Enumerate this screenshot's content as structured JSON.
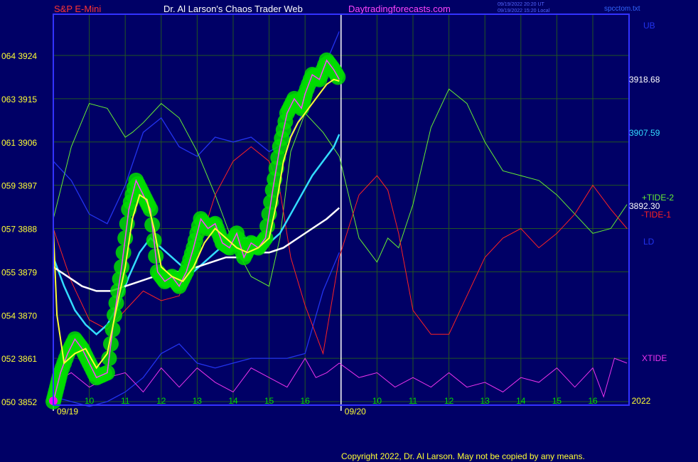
{
  "header": {
    "instrument": "S&P E-Mini",
    "site_title": "Dr. Al Larson's Chaos Trader Web",
    "website": "Daytradingforecasts.com",
    "time_ut": "09/19/2022 20:20 UT",
    "time_local": "09/19/2022 15:20 Local",
    "data_file": "spcctom.txt"
  },
  "footer": {
    "copyright": "Copyright 2022, Dr. Al Larson. May not be copied by any means."
  },
  "colors": {
    "background": "#000066",
    "frame": "#3333ff",
    "grid": "#225522",
    "price_green": "#00dd00",
    "price_magenta": "#ff44ff",
    "yellow_ma": "#ffff33",
    "cyan_ma": "#33ddff",
    "white_ma": "#ffffff",
    "band_blue": "#2233ee",
    "tide_green": "#66ee33",
    "tide_red": "#ff2222",
    "xtide": "#ee33ee"
  },
  "chart_data": {
    "type": "line",
    "title": "S&P E-Mini",
    "x_ticks": [
      "09/19",
      "10",
      "11",
      "12",
      "13",
      "14",
      "15",
      "16",
      "09/20",
      "10",
      "11",
      "12",
      "13",
      "14",
      "15",
      "16",
      "2022"
    ],
    "y_ticks": [
      {
        "value": 3852,
        "label": "050  3852"
      },
      {
        "value": 3861,
        "label": "052  3861"
      },
      {
        "value": 3870,
        "label": "054  3870"
      },
      {
        "value": 3879,
        "label": "055  3879"
      },
      {
        "value": 3888,
        "label": "057  3888"
      },
      {
        "value": 3897,
        "label": "059  3897"
      },
      {
        "value": 3906,
        "label": "061  3906"
      },
      {
        "value": 3915,
        "label": "063  3915"
      },
      {
        "value": 3924,
        "label": "064  3924"
      }
    ],
    "ylim": [
      3852,
      3924
    ],
    "grid": true,
    "right_labels": {
      "ub": "UB",
      "ld": "LD",
      "tide_plus": "+TIDE-2",
      "tide_minus": "-TIDE-1",
      "xtide": "XTIDE",
      "price_yellow": "3918.68",
      "price_cyan": "3907.59",
      "price_white": "3892.30"
    },
    "price_x": [
      0,
      0.1,
      0.2,
      0.4,
      0.6,
      0.8,
      1.0,
      1.2,
      1.5,
      1.7,
      1.9,
      2.1,
      2.3,
      2.5,
      2.7,
      2.9,
      3.1,
      3.3,
      3.5,
      3.7,
      3.9,
      4.1,
      4.3,
      4.5,
      4.7,
      4.9,
      5.1,
      5.3,
      5.5,
      5.7,
      5.9,
      6.1,
      6.3,
      6.5,
      6.7,
      6.9,
      7.0,
      7.2,
      7.4,
      7.6,
      7.8,
      7.95
    ],
    "price": [
      3852,
      3855,
      3858,
      3862,
      3865,
      3863,
      3860,
      3857,
      3858,
      3870,
      3880,
      3892,
      3898,
      3895,
      3892,
      3879,
      3877,
      3878,
      3876,
      3879,
      3884,
      3890,
      3888,
      3889,
      3885,
      3884,
      3887,
      3882,
      3885,
      3884,
      3886,
      3896,
      3905,
      3912,
      3915,
      3913,
      3916,
      3920,
      3919,
      3923,
      3921,
      3919
    ],
    "series": [
      {
        "name": "yellow",
        "x": [
          0,
          0.1,
          0.3,
          0.6,
          0.9,
          1.2,
          1.5,
          1.8,
          2.0,
          2.2,
          2.4,
          2.6,
          2.8,
          3.0,
          3.3,
          3.6,
          3.9,
          4.2,
          4.5,
          4.8,
          5.1,
          5.4,
          5.7,
          6.0,
          6.2,
          6.4,
          6.6,
          6.8,
          7.0,
          7.2,
          7.4,
          7.6,
          7.8,
          7.95
        ],
        "y": [
          3888,
          3870,
          3860,
          3862,
          3863,
          3859,
          3862,
          3873,
          3880,
          3890,
          3895,
          3894,
          3888,
          3880,
          3878,
          3877,
          3880,
          3885,
          3888,
          3886,
          3884,
          3883,
          3884,
          3886,
          3893,
          3902,
          3907,
          3910,
          3912,
          3914,
          3916,
          3918,
          3919,
          3918.68
        ]
      },
      {
        "name": "cyan",
        "x": [
          0,
          0.3,
          0.6,
          0.9,
          1.2,
          1.5,
          1.8,
          2.1,
          2.4,
          2.7,
          3.0,
          3.3,
          3.6,
          3.9,
          4.2,
          4.5,
          4.8,
          5.1,
          5.4,
          5.7,
          6.0,
          6.3,
          6.6,
          6.9,
          7.2,
          7.5,
          7.8,
          7.95
        ],
        "y": [
          3882,
          3876,
          3871,
          3868,
          3866,
          3868,
          3872,
          3878,
          3883,
          3886,
          3884,
          3882,
          3880,
          3879,
          3881,
          3883,
          3885,
          3886,
          3886,
          3885,
          3885,
          3887,
          3891,
          3895,
          3899,
          3902,
          3905,
          3907.59
        ]
      },
      {
        "name": "white",
        "x": [
          0,
          0.4,
          0.8,
          1.2,
          1.6,
          2.0,
          2.4,
          2.8,
          3.2,
          3.6,
          4.0,
          4.4,
          4.8,
          5.2,
          5.6,
          6.0,
          6.4,
          6.8,
          7.2,
          7.6,
          7.95
        ],
        "y": [
          3880,
          3878,
          3876,
          3875,
          3875,
          3876,
          3877,
          3878,
          3879,
          3879,
          3880,
          3881,
          3882,
          3882,
          3883,
          3883,
          3884,
          3886,
          3888,
          3890,
          3892.3
        ]
      },
      {
        "name": "upper_band",
        "x": [
          0,
          0.5,
          1.0,
          1.5,
          2.0,
          2.5,
          3.0,
          3.5,
          4.0,
          4.5,
          5.0,
          5.5,
          6.0,
          6.5,
          7.0,
          7.5,
          7.95
        ],
        "y": [
          3902,
          3898,
          3891,
          3889,
          3897,
          3908,
          3911,
          3905,
          3903,
          3907,
          3906,
          3907,
          3904,
          3906,
          3913,
          3921,
          3929
        ]
      },
      {
        "name": "lower_band",
        "x": [
          0,
          0.5,
          1.0,
          1.5,
          2.0,
          2.5,
          3.0,
          3.5,
          4.0,
          4.5,
          5.0,
          5.5,
          6.0,
          6.5,
          7.0,
          7.5,
          7.95
        ],
        "y": [
          3853,
          3852,
          3851,
          3852,
          3854,
          3857,
          3862,
          3864,
          3860,
          3859,
          3860,
          3861,
          3861,
          3861,
          3862,
          3875,
          3883
        ]
      },
      {
        "name": "+TIDE-2",
        "x": [
          0,
          0.5,
          1.0,
          1.5,
          2.0,
          2.2,
          2.5,
          3.0,
          3.5,
          4.0,
          4.5,
          5.0,
          5.5,
          6.0,
          6.3,
          6.6,
          7.0,
          7.5,
          7.95,
          8.5,
          9.0,
          9.3,
          9.6,
          10.0,
          10.5,
          11.0,
          11.5,
          12.0,
          12.5,
          13.0,
          13.5,
          14.0,
          14.5,
          15.0,
          15.5,
          15.95
        ],
        "y": [
          3890,
          3905,
          3914,
          3913,
          3907,
          3908,
          3910,
          3914,
          3911,
          3904,
          3895,
          3885,
          3878,
          3876,
          3886,
          3904,
          3912,
          3908,
          3903,
          3886,
          3881,
          3886,
          3884,
          3893,
          3909,
          3917,
          3914,
          3906,
          3900,
          3899,
          3898,
          3895,
          3891,
          3887,
          3888,
          3893
        ]
      },
      {
        "name": "-TIDE-1",
        "x": [
          0,
          0.5,
          1.0,
          1.5,
          2.0,
          2.5,
          3.0,
          3.5,
          4.0,
          4.5,
          5.0,
          5.5,
          6.0,
          6.3,
          6.6,
          7.0,
          7.5,
          7.95,
          8.5,
          9.0,
          9.3,
          9.6,
          10.0,
          10.5,
          11.0,
          11.5,
          12.0,
          12.5,
          13.0,
          13.5,
          14.0,
          14.5,
          15.0,
          15.5,
          15.95
        ],
        "y": [
          3888,
          3877,
          3869,
          3867,
          3871,
          3875,
          3873,
          3874,
          3883,
          3895,
          3902,
          3905,
          3902,
          3896,
          3882,
          3872,
          3862,
          3882,
          3895,
          3899,
          3896,
          3887,
          3871,
          3866,
          3866,
          3874,
          3882,
          3886,
          3888,
          3884,
          3887,
          3891,
          3897,
          3892,
          3888
        ]
      },
      {
        "name": "XTIDE",
        "x": [
          0,
          0.5,
          1.0,
          1.5,
          2.0,
          2.5,
          3.0,
          3.5,
          4.0,
          4.5,
          5.0,
          5.5,
          6.0,
          6.5,
          7.0,
          7.3,
          7.6,
          7.95,
          8.5,
          9.0,
          9.5,
          10.0,
          10.5,
          11.0,
          11.5,
          12.0,
          12.5,
          13.0,
          13.5,
          14.0,
          14.5,
          15.0,
          15.3,
          15.6,
          15.95
        ],
        "y": [
          3856,
          3858,
          3855,
          3857,
          3858,
          3854,
          3859,
          3855,
          3859,
          3856,
          3854,
          3859,
          3857,
          3855,
          3861,
          3857,
          3858,
          3860,
          3857,
          3858,
          3855,
          3857,
          3855,
          3858,
          3855,
          3856,
          3854,
          3857,
          3856,
          3859,
          3855,
          3859,
          3853,
          3861,
          3860
        ]
      }
    ]
  }
}
